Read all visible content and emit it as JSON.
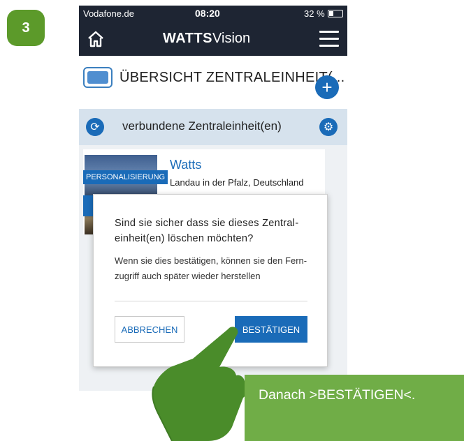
{
  "step": {
    "number": "3"
  },
  "statusbar": {
    "carrier": "Vodafone.de",
    "time": "08:20",
    "battery": "32 %"
  },
  "navbar": {
    "brand_bold": "WATTS",
    "brand_light": "Vision"
  },
  "overview": {
    "title": "ÜBERSICHT ZENTRALEINHEIT(..."
  },
  "connected": {
    "label": "verbundene Zentraleinheit(en)"
  },
  "card": {
    "title": "Watts",
    "location": "Landau in der Pfalz, Deutschland",
    "tag": "PERSONALISIERUNG"
  },
  "dialog": {
    "title": "Sind sie sicher dass sie dieses Zentral-einheit(en) löschen möchten?",
    "message": "Wenn sie dies bestätigen, können sie den Fern-zugriff auch später wieder herstellen",
    "cancel_label": "ABBRECHEN",
    "confirm_label": "BESTÄTIGEN"
  },
  "caption": {
    "text": "Danach >BESTÄTIGEN<."
  },
  "colors": {
    "accent": "#1a6bb8",
    "navbar": "#1e2533",
    "caption_green": "#70ad47",
    "step_green": "#5c9a2a"
  }
}
